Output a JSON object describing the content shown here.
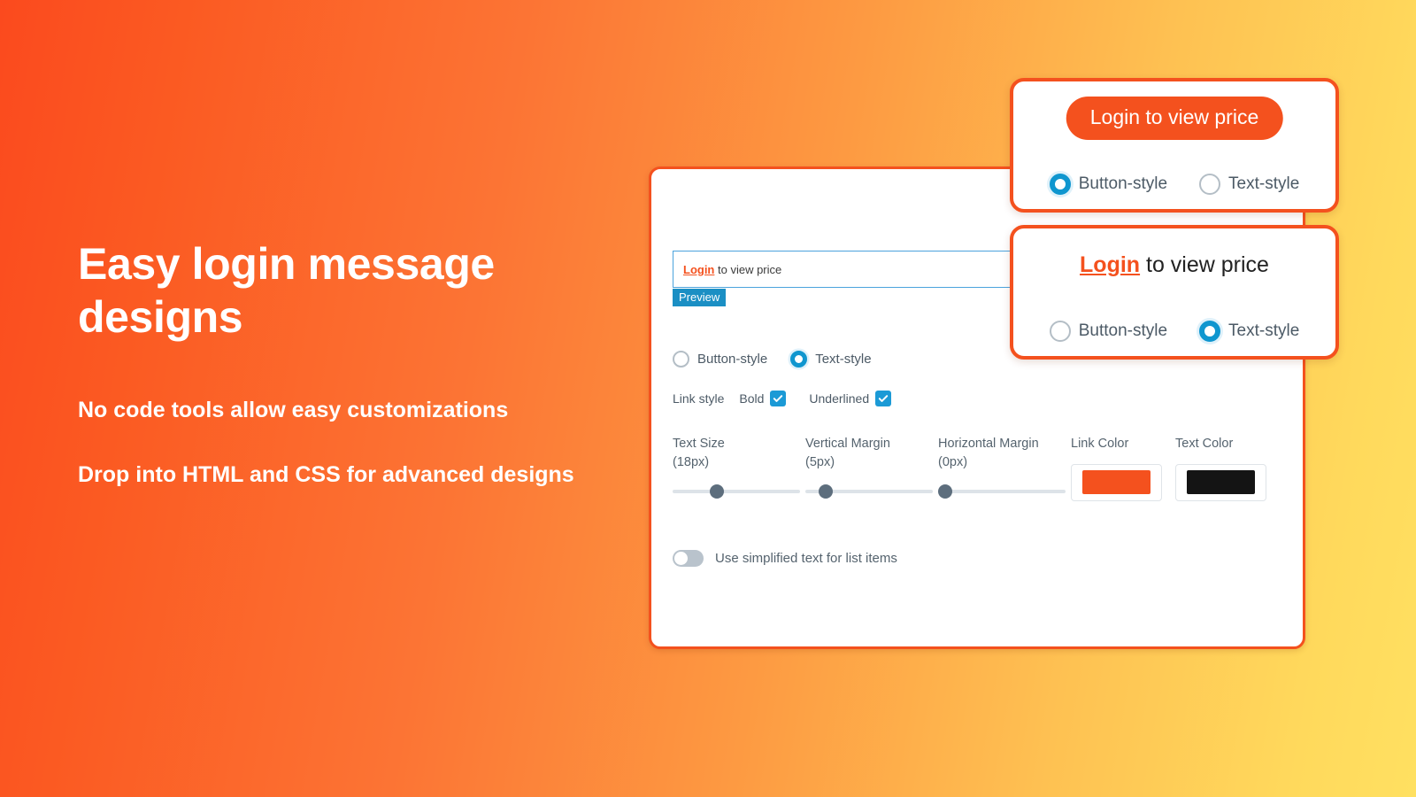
{
  "hero": {
    "title": "Easy login message designs",
    "sub1": "No code tools allow easy customizations",
    "sub2": "Drop into HTML and CSS for advanced designs"
  },
  "colors": {
    "brand_orange": "#f4511e",
    "link_orange": "#f4511e",
    "accent_blue": "#1b9ad6",
    "radio_blue": "#0f96cf",
    "text_black": "#111111",
    "gradient_start": "#fb4a1e",
    "gradient_end": "#ffe061"
  },
  "panel": {
    "preview_input": {
      "link_text": "Login",
      "rest_text": " to view price",
      "value": "Login to view price"
    },
    "preview_tag": "Preview",
    "style_radios": {
      "options": [
        {
          "label": "Button-style",
          "selected": false
        },
        {
          "label": "Text-style",
          "selected": true
        }
      ]
    },
    "link_style": {
      "label": "Link style",
      "checkboxes": [
        {
          "label": "Bold",
          "checked": true
        },
        {
          "label": "Underlined",
          "checked": true
        }
      ]
    },
    "sliders": [
      {
        "label": "Text Size",
        "value_label": "(18px)",
        "value": 18,
        "percent": 33
      },
      {
        "label": "Vertical Margin",
        "value_label": "(5px)",
        "value": 5,
        "percent": 12
      },
      {
        "label": "Horizontal Margin",
        "value_label": "(0px)",
        "value": 0,
        "percent": 0
      }
    ],
    "color_pickers": [
      {
        "label": "Link Color",
        "color": "#f4511e"
      },
      {
        "label": "Text Color",
        "color": "#141414"
      }
    ],
    "simplified_toggle": {
      "label": "Use simplified text for list items",
      "on": false
    }
  },
  "cards": [
    {
      "kind": "button-style",
      "button_label": "Login to view price",
      "radios": [
        {
          "label": "Button-style",
          "selected": true
        },
        {
          "label": "Text-style",
          "selected": false
        }
      ]
    },
    {
      "kind": "text-style",
      "link_text": "Login",
      "rest_text": " to view price",
      "radios": [
        {
          "label": "Button-style",
          "selected": false
        },
        {
          "label": "Text-style",
          "selected": true
        }
      ]
    }
  ]
}
